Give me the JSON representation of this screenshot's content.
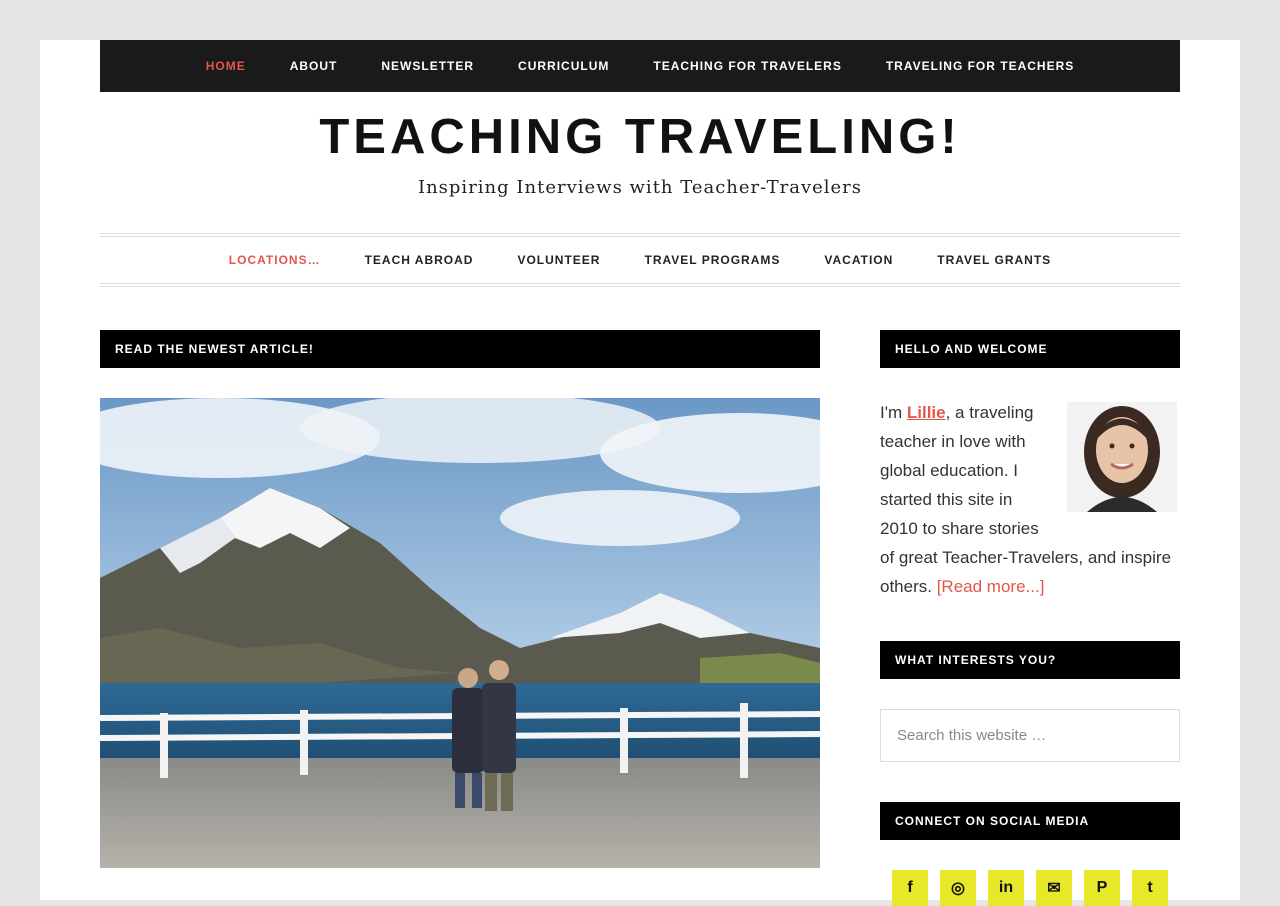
{
  "top_nav": [
    {
      "label": "HOME",
      "active": true
    },
    {
      "label": "ABOUT"
    },
    {
      "label": "NEWSLETTER"
    },
    {
      "label": "CURRICULUM"
    },
    {
      "label": "TEACHING FOR TRAVELERS"
    },
    {
      "label": "TRAVELING FOR TEACHERS"
    }
  ],
  "site": {
    "title": "TEACHING TRAVELING!",
    "tagline": "Inspiring Interviews with Teacher-Travelers"
  },
  "sub_nav": [
    {
      "label": "LOCATIONS…",
      "active": true
    },
    {
      "label": "TEACH ABROAD"
    },
    {
      "label": "VOLUNTEER"
    },
    {
      "label": "TRAVEL PROGRAMS"
    },
    {
      "label": "VACATION"
    },
    {
      "label": "TRAVEL GRANTS"
    }
  ],
  "main": {
    "section_title": "READ THE NEWEST ARTICLE!"
  },
  "sidebar": {
    "welcome_title": "HELLO AND WELCOME",
    "welcome_intro": "I'm ",
    "welcome_name": "Lillie",
    "welcome_text": ", a traveling teacher in love with global education. I started this site in 2010 to share stories of great Teacher-Travelers, and inspire others. ",
    "read_more": "[Read more...]",
    "interests_title": "WHAT INTERESTS YOU?",
    "search_placeholder": "Search this website …",
    "social_title": "CONNECT ON SOCIAL MEDIA",
    "social_icons": [
      "facebook-icon",
      "instagram-icon",
      "linkedin-icon",
      "email-icon",
      "pinterest-icon",
      "twitter-icon"
    ]
  },
  "colors": {
    "accent": "#e2574c",
    "nav_bg": "#1a1a1a",
    "social_bg": "#e8e82a"
  }
}
